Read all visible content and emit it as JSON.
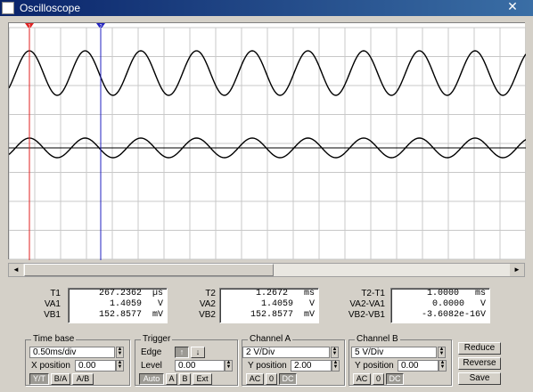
{
  "window": {
    "title": "Oscilloscope",
    "close_glyph": "✕"
  },
  "cursors": [
    {
      "id": "1",
      "color": "#e02020"
    },
    {
      "id": "2",
      "color": "#2020c0"
    }
  ],
  "readout": {
    "t1": {
      "labels": [
        "T1",
        "VA1",
        "VB1"
      ],
      "values": [
        "267.2362  µs",
        "1.4059   V",
        "152.8577  mV"
      ]
    },
    "t2": {
      "labels": [
        "T2",
        "VA2",
        "VB2"
      ],
      "values": [
        "1.2672   ms",
        "1.4059   V",
        "152.8577  mV"
      ]
    },
    "diff": {
      "labels": [
        "T2-T1",
        "VA2-VA1",
        "VB2-VB1"
      ],
      "values": [
        "1.0000   ms",
        "0.0000   V",
        "-3.6082e-16V"
      ]
    }
  },
  "timebase": {
    "title": "Time base",
    "scale": "0.50ms/div",
    "xpos_label": "X position",
    "xpos": "0.00",
    "modes": [
      "Y/T",
      "B/A",
      "A/B"
    ]
  },
  "trigger": {
    "title": "Trigger",
    "edge_label": "Edge",
    "level_label": "Level",
    "level": "0.00",
    "buttons": [
      "Auto",
      "A",
      "B",
      "Ext"
    ]
  },
  "channel_a": {
    "title": "Channel A",
    "scale": "2 V/Div",
    "ypos_label": "Y position",
    "ypos": "2.00",
    "coupling": [
      "AC",
      "0",
      "DC"
    ]
  },
  "channel_b": {
    "title": "Channel B",
    "scale": "5 V/Div",
    "ypos_label": "Y position",
    "ypos": "0.00",
    "coupling": [
      "AC",
      "0",
      "DC"
    ]
  },
  "actions": {
    "reduce": "Reduce",
    "reverse": "Reverse",
    "save": "Save"
  },
  "icons": {
    "window_icon": "app-icon",
    "edge_rising": "rising-edge-icon",
    "edge_falling": "falling-edge-icon"
  }
}
